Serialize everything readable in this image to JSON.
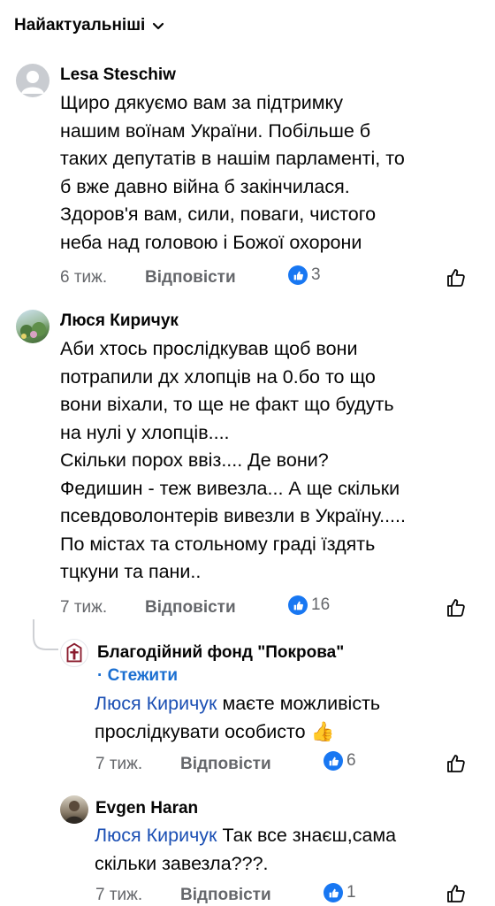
{
  "sort": {
    "label": "Найактуальніші"
  },
  "comments": [
    {
      "author": "Lesa Steschiw",
      "text": "Щиро дякуємо вам за підтримку\nнашим воїнам України. Побільше б\nтаких депутатів в нашім парламенті, то\nб вже давно війна б закінчилася.\nЗдоров'я вам, сили, поваги, чистого\nнеба над головою і Божої охорони",
      "time": "6 тиж.",
      "reply": "Відповісти",
      "likes": "3"
    },
    {
      "author": "Люся Киричук",
      "text": "Аби хтось прослідкував щоб вони\nпотрапили дх хлопців на 0.бо то що\nвони віхали, то ще не факт що будуть\nна нулі у хлопців....\nСкільки порох ввіз.... Де вони?\nФедишин - теж вивезла... А ще скільки\nпсевдоволонтерів вивезли в Україну.....\nПо містах та стольному  граді їздять\nтцкуни та пани..",
      "time": "7 тиж.",
      "reply": "Відповісти",
      "likes": "16"
    }
  ],
  "replies": [
    {
      "author": "Благодійний фонд \"Покрова\"",
      "follow": "· Стежити",
      "mention": "Люся Киричук",
      "text_line1": " маєте можливість",
      "text_rest": "прослідкувати особисто 👍",
      "time": "7 тиж.",
      "reply": "Відповісти",
      "likes": "6"
    },
    {
      "author": "Evgen Haran",
      "mention": "Люся Киричук",
      "text_line1": " Так все знаєш,сама",
      "text_rest": "скільки завезла???.",
      "time": "7 тиж.",
      "reply": "Відповісти",
      "likes": "1"
    }
  ]
}
